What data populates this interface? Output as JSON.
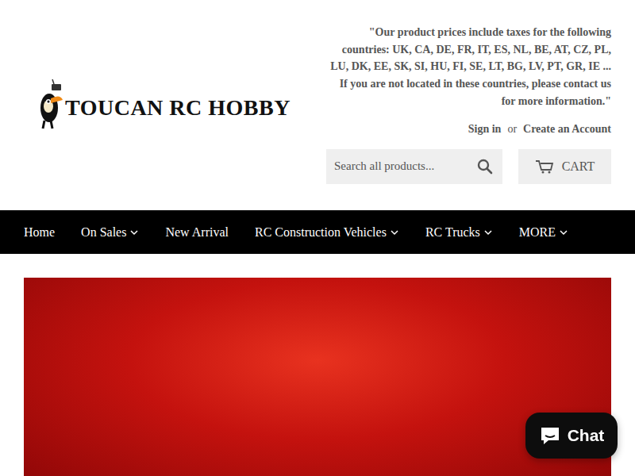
{
  "logo": {
    "text": "TOUCAN RC HOBBY"
  },
  "notice": "\"Our product prices include taxes for the following countries: UK, CA, DE, FR, IT, ES, NL, BE, AT, CZ, PL, LU, DK, EE, SK, SI, HU, FI, SE, LT, BG, LV, PT, GR, IE ... If you are not located in these countries, please contact us for more information.\"",
  "account": {
    "sign_in": "Sign in",
    "separator": "or",
    "create": "Create an Account"
  },
  "search": {
    "placeholder": "Search all products..."
  },
  "cart": {
    "label": "CART"
  },
  "nav": [
    {
      "label": "Home",
      "dropdown": false
    },
    {
      "label": "On Sales",
      "dropdown": true
    },
    {
      "label": "New Arrival",
      "dropdown": false
    },
    {
      "label": "RC Construction Vehicles",
      "dropdown": true
    },
    {
      "label": "RC Trucks",
      "dropdown": true
    },
    {
      "label": "MORE",
      "dropdown": true
    }
  ],
  "chat": {
    "label": "Chat"
  }
}
